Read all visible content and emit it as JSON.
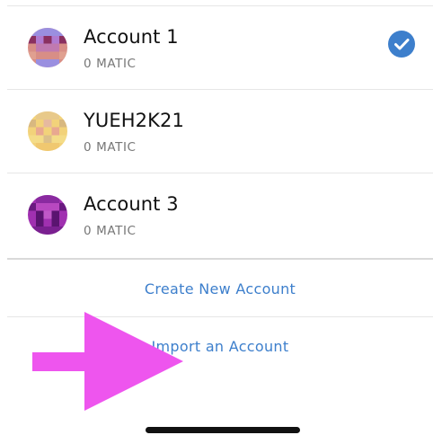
{
  "accounts": [
    {
      "name": "Account 1",
      "balance": "0 MATIC",
      "selected": true
    },
    {
      "name": "YUEH2K21",
      "balance": "0 MATIC",
      "selected": false
    },
    {
      "name": "Account 3",
      "balance": "0 MATIC",
      "selected": false
    }
  ],
  "actions": {
    "create_label": "Create New Account",
    "import_label": "Import an Account"
  },
  "colors": {
    "link": "#3d7fcc",
    "check": "#3d7fcc",
    "annotation_arrow": "#ee55ee"
  },
  "icons": {
    "selected": "checkmark-circle-icon",
    "pointer": "arrow-annotation"
  }
}
